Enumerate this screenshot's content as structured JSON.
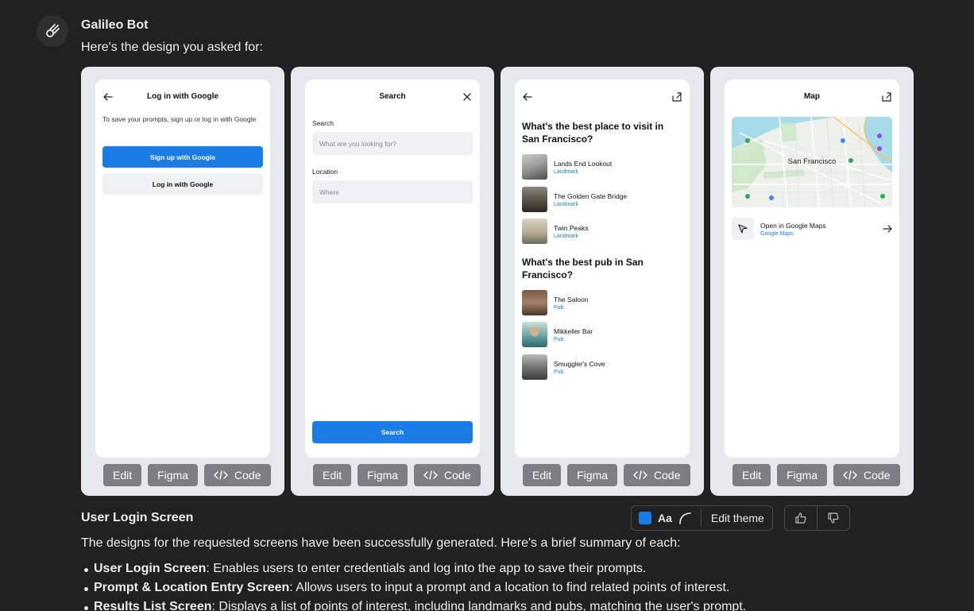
{
  "bot": {
    "name": "Galileo Bot",
    "intro": "Here's the design you asked for:"
  },
  "card_actions": {
    "edit": "Edit",
    "figma": "Figma",
    "code": "Code"
  },
  "login_screen": {
    "title": "Log in with Google",
    "description": "To save your prompts, sign up or log in with Google",
    "signup_button": "Sign up with Google",
    "login_button": "Log in with Google"
  },
  "search_screen": {
    "title": "Search",
    "search_label": "Search",
    "search_placeholder": "What are you looking for?",
    "location_label": "Location",
    "location_placeholder": "Where",
    "search_button": "Search"
  },
  "results_screen": {
    "sections": [
      {
        "question": "What's the best place to visit in San Francisco?",
        "items": [
          {
            "name": "Lands End Lookout",
            "type": "Landmark"
          },
          {
            "name": "The Golden Gate Bridge",
            "type": "Landmark"
          },
          {
            "name": "Twin Peaks",
            "type": "Landmark"
          }
        ]
      },
      {
        "question": "What's the best pub in San Francisco?",
        "items": [
          {
            "name": "The Saloon",
            "type": "Pub"
          },
          {
            "name": "Mikkeller Bar",
            "type": "Pub"
          },
          {
            "name": "Smuggler's Cove",
            "type": "Pub"
          }
        ]
      }
    ]
  },
  "map_screen": {
    "title": "Map",
    "map_label": "San Francisco",
    "open_title": "Open in Google Maps",
    "open_subtitle": "Google Maps"
  },
  "caption": "User Login Screen",
  "theme": {
    "aa": "Aa",
    "edit_label": "Edit theme",
    "accent": "#1b7ce6"
  },
  "summary": "The designs for the requested screens have been successfully generated. Here's a brief summary of each:",
  "bullets": [
    {
      "term": "User Login Screen",
      "text": ": Enables users to enter credentials and log into the app to save their prompts."
    },
    {
      "term": "Prompt & Location Entry Screen",
      "text": ": Allows users to input a prompt and a location to find related points of interest."
    },
    {
      "term": "Results List Screen",
      "text": ": Displays a list of points of interest, including landmarks and pubs, matching the user's prompt."
    }
  ]
}
